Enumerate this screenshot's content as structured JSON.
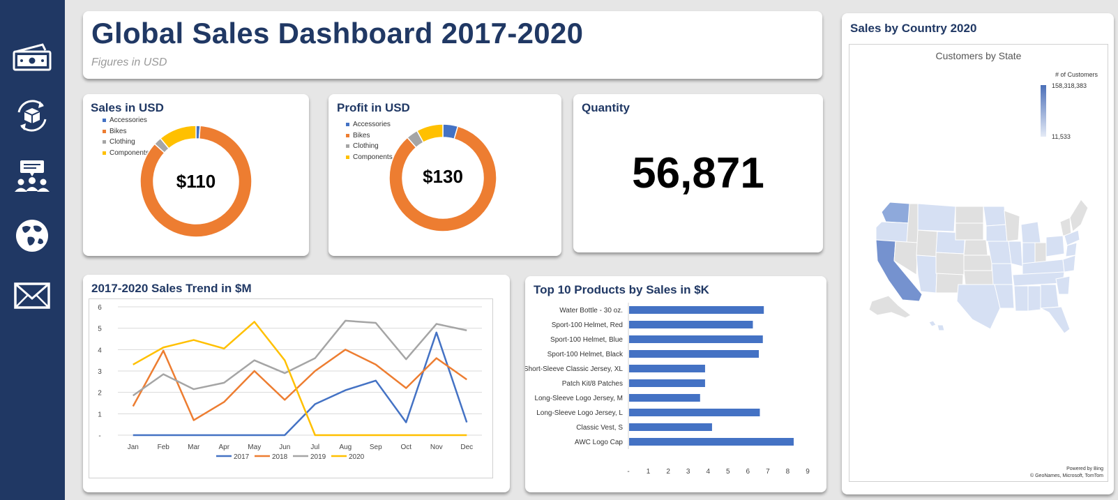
{
  "sidebar": {
    "icons": [
      {
        "name": "money-icon"
      },
      {
        "name": "product-cycle-icon"
      },
      {
        "name": "customers-icon"
      },
      {
        "name": "globe-icon"
      },
      {
        "name": "mail-icon"
      }
    ]
  },
  "header": {
    "title": "Global Sales Dashboard 2017-2020",
    "subtitle": "Figures in USD"
  },
  "colors": {
    "navy": "#203864",
    "accessories": "#4472c4",
    "bikes": "#ed7d31",
    "clothing": "#a5a5a5",
    "components": "#ffc000",
    "bar": "#4472c4"
  },
  "sales_card": {
    "title": "Sales in USD",
    "center_value": "$110",
    "legend": [
      "Accessories",
      "Bikes",
      "Clothing",
      "Components"
    ]
  },
  "profit_card": {
    "title": "Profit in USD",
    "center_value": "$130",
    "legend": [
      "Accessories",
      "Bikes",
      "Clothing",
      "Components"
    ]
  },
  "quantity_card": {
    "title": "Quantity",
    "value": "56,871"
  },
  "trend_card": {
    "title": "2017-2020 Sales Trend in $M"
  },
  "top_products_card": {
    "title": "Top 10 Products by Sales in $K"
  },
  "map_card": {
    "title": "Sales by Country 2020",
    "map_title": "Customers by State",
    "legend_title": "# of Customers",
    "legend_max": "158,318,383",
    "legend_min": "11,533",
    "credit_line1": "Powered by Bing",
    "credit_line2": "© GeoNames, Microsoft, TomTom"
  },
  "chart_data": [
    {
      "type": "pie",
      "title": "Sales in USD",
      "categories": [
        "Accessories",
        "Bikes",
        "Clothing",
        "Components"
      ],
      "values": [
        1.2,
        85.5,
        2.3,
        11.0
      ]
    },
    {
      "type": "pie",
      "title": "Profit in USD",
      "categories": [
        "Accessories",
        "Bikes",
        "Clothing",
        "Components"
      ],
      "values": [
        4.5,
        84.0,
        3.5,
        8.0
      ]
    },
    {
      "type": "line",
      "title": "2017-2020 Sales Trend in $M",
      "categories": [
        "Jan",
        "Feb",
        "Mar",
        "Apr",
        "May",
        "Jun",
        "Jul",
        "Aug",
        "Sep",
        "Oct",
        "Nov",
        "Dec"
      ],
      "ylim": [
        0,
        6
      ],
      "yticks": [
        "-",
        "1",
        "2",
        "3",
        "4",
        "5",
        "6"
      ],
      "grid": true,
      "legend_position": "bottom",
      "series": [
        {
          "name": "2017",
          "values": [
            0,
            0,
            0,
            0,
            0,
            0,
            1.45,
            2.1,
            2.55,
            0.6,
            4.8,
            0.6
          ]
        },
        {
          "name": "2018",
          "values": [
            1.35,
            3.95,
            0.7,
            1.55,
            3.0,
            1.65,
            3.0,
            4.0,
            3.3,
            2.2,
            3.6,
            2.6
          ]
        },
        {
          "name": "2019",
          "values": [
            1.85,
            2.85,
            2.15,
            2.45,
            3.5,
            2.9,
            3.6,
            5.35,
            5.25,
            3.55,
            5.2,
            4.9
          ]
        },
        {
          "name": "2020",
          "values": [
            3.3,
            4.1,
            4.45,
            4.05,
            5.3,
            3.5,
            0,
            0,
            0,
            0,
            0,
            0
          ]
        }
      ]
    },
    {
      "type": "bar",
      "orientation": "horizontal",
      "title": "Top 10 Products by Sales in $K",
      "categories": [
        "Water Bottle - 30 oz.",
        "Sport-100 Helmet, Red",
        "Sport-100 Helmet, Blue",
        "Sport-100 Helmet, Black",
        "Short-Sleeve Classic Jersey, XL",
        "Patch Kit/8 Patches",
        "Long-Sleeve Logo Jersey, M",
        "Long-Sleeve Logo Jersey, L",
        "Classic Vest, S",
        "AWC Logo Cap"
      ],
      "values": [
        6.8,
        6.25,
        6.75,
        6.55,
        3.85,
        3.85,
        3.6,
        6.6,
        4.2,
        8.3
      ],
      "xlim": [
        0,
        9
      ],
      "xticks": [
        "-",
        "1",
        "2",
        "3",
        "4",
        "5",
        "6",
        "7",
        "8",
        "9"
      ]
    }
  ]
}
